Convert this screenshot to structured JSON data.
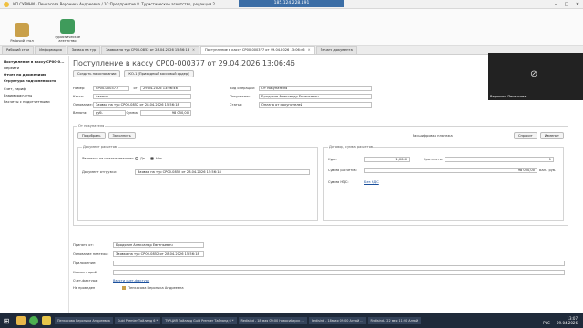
{
  "remote": {
    "ip": "185.124.228.191"
  },
  "window": {
    "title": "ИП СУРИНИ - Пенкасова Вероника Андреевна / 1С:Предприятие 8. Туристическое агентство, редакция 2"
  },
  "sections": [
    {
      "label": "Рабочий стол",
      "color": "#c9a04a"
    },
    {
      "label": "Туристическое агентство",
      "color": "#3f9b5b"
    }
  ],
  "tabs": [
    {
      "label": "Рабочий стол"
    },
    {
      "label": "Информация"
    },
    {
      "label": "Заявка на тур"
    },
    {
      "label": "Заявка на тур СР00-0852 от 28.04.2026 15:56:18"
    },
    {
      "label": "Поступление в кассу СР00-000377 от 29.04.2026 13:06:46",
      "active": true
    },
    {
      "label": "Печать документа"
    }
  ],
  "leftnav": {
    "items": [
      "Поступление в кассу СР00-0...",
      "Перейти",
      "Отчет по движениям",
      "Структура подчиненности",
      "Счет, тариф",
      "Взаиморасчеты",
      "Расчеты с подотчетными"
    ]
  },
  "doc": {
    "title": "Поступление в кассу СР00-000377 от 29.04.2026 13:06:46",
    "toolbar": {
      "create": "Создать на основании",
      "print": "КО-1 (Приходный кассовый ордер)"
    },
    "fields": {
      "number_label": "Номер:",
      "number": "СР00-000377",
      "date_label": "от:",
      "date": "29.04.2026 13:06:46",
      "kassa_label": "Касса:",
      "kassa": "Авансы",
      "osnovanie_label": "Основание:",
      "osnovanie": "Заявка на тур СР00-0852 от 28.04.2026 15:56:18",
      "valuta_label": "Валюта:",
      "valuta": "руб.",
      "summa_label": "Сумма:",
      "summa": "98 050,00",
      "vid_label": "Вид операции:",
      "vid": "От покупателя",
      "plat_label": "Покупатель:",
      "plat": "Бродягин Александр Евгеньевич",
      "statya_label": "Статья:",
      "statya": "Оплата от покупателей"
    },
    "pay_panel": {
      "title": "От покупателя",
      "btn_podbor": "Подобрать",
      "btn_zapolnit": "Заполнить",
      "right_label": "Расшифровка платежа",
      "btn_sprosit": "Спросит",
      "btn_izmenit": "Изменит",
      "docs_title": "Документ расчетов",
      "avans_label": "Является ли платеж авансом:",
      "avans_no": "Да",
      "avans_yes": "Нет",
      "doc_label": "Документ отгрузки:",
      "doc_value": "Заявка на тур СР00-0852 от 28.04.2026 15:56:18",
      "dogovor_title": "Договор, сумма расчетов",
      "kurs_label": "Курс:",
      "kurs": "1,0000",
      "kratn_label": "Кратность:",
      "kratn": "1",
      "summa_label": "Сумма расчетов:",
      "summa": "98 050,00",
      "summa_unit": "Вал.: руб.",
      "nds_label": "Сумма НДС:",
      "nds": "Без НДС"
    },
    "bottom": {
      "prinyato_label": "Принято от:",
      "prinyato": "Бродягин Александр Евгеньевич",
      "osnov_label": "Основание платежа:",
      "osnov": "Заявка на тур СР00-0852 от 28.04.2026 15:56:18",
      "pril_label": "Приложение:",
      "pril": "",
      "comment_label": "Комментарий:",
      "comment": "",
      "schet_label": "Счет-фактура:",
      "schet": "Ввести счет-фактуру",
      "status": "Не проведен",
      "author": "Пенкасова Вероника Андреевна"
    }
  },
  "video": {
    "name": "Вероника Пенкасова"
  },
  "taskbar": {
    "items": [
      "Пенкасова Вероника Андреевна",
      "Guid Premier Тайланд 6 *",
      "ТУРЦИЯ Тайланд Guid Premier Тайланд 6 *",
      "Redisind - 18 мая 09:00 Новосибирск ...",
      "Redisind - 18 мая 09:00 Алтай ...",
      "Redisind - 22 мая 11:20 Алтай"
    ],
    "lang": "РУС",
    "time": "13:07",
    "date": "29.04.2026"
  }
}
